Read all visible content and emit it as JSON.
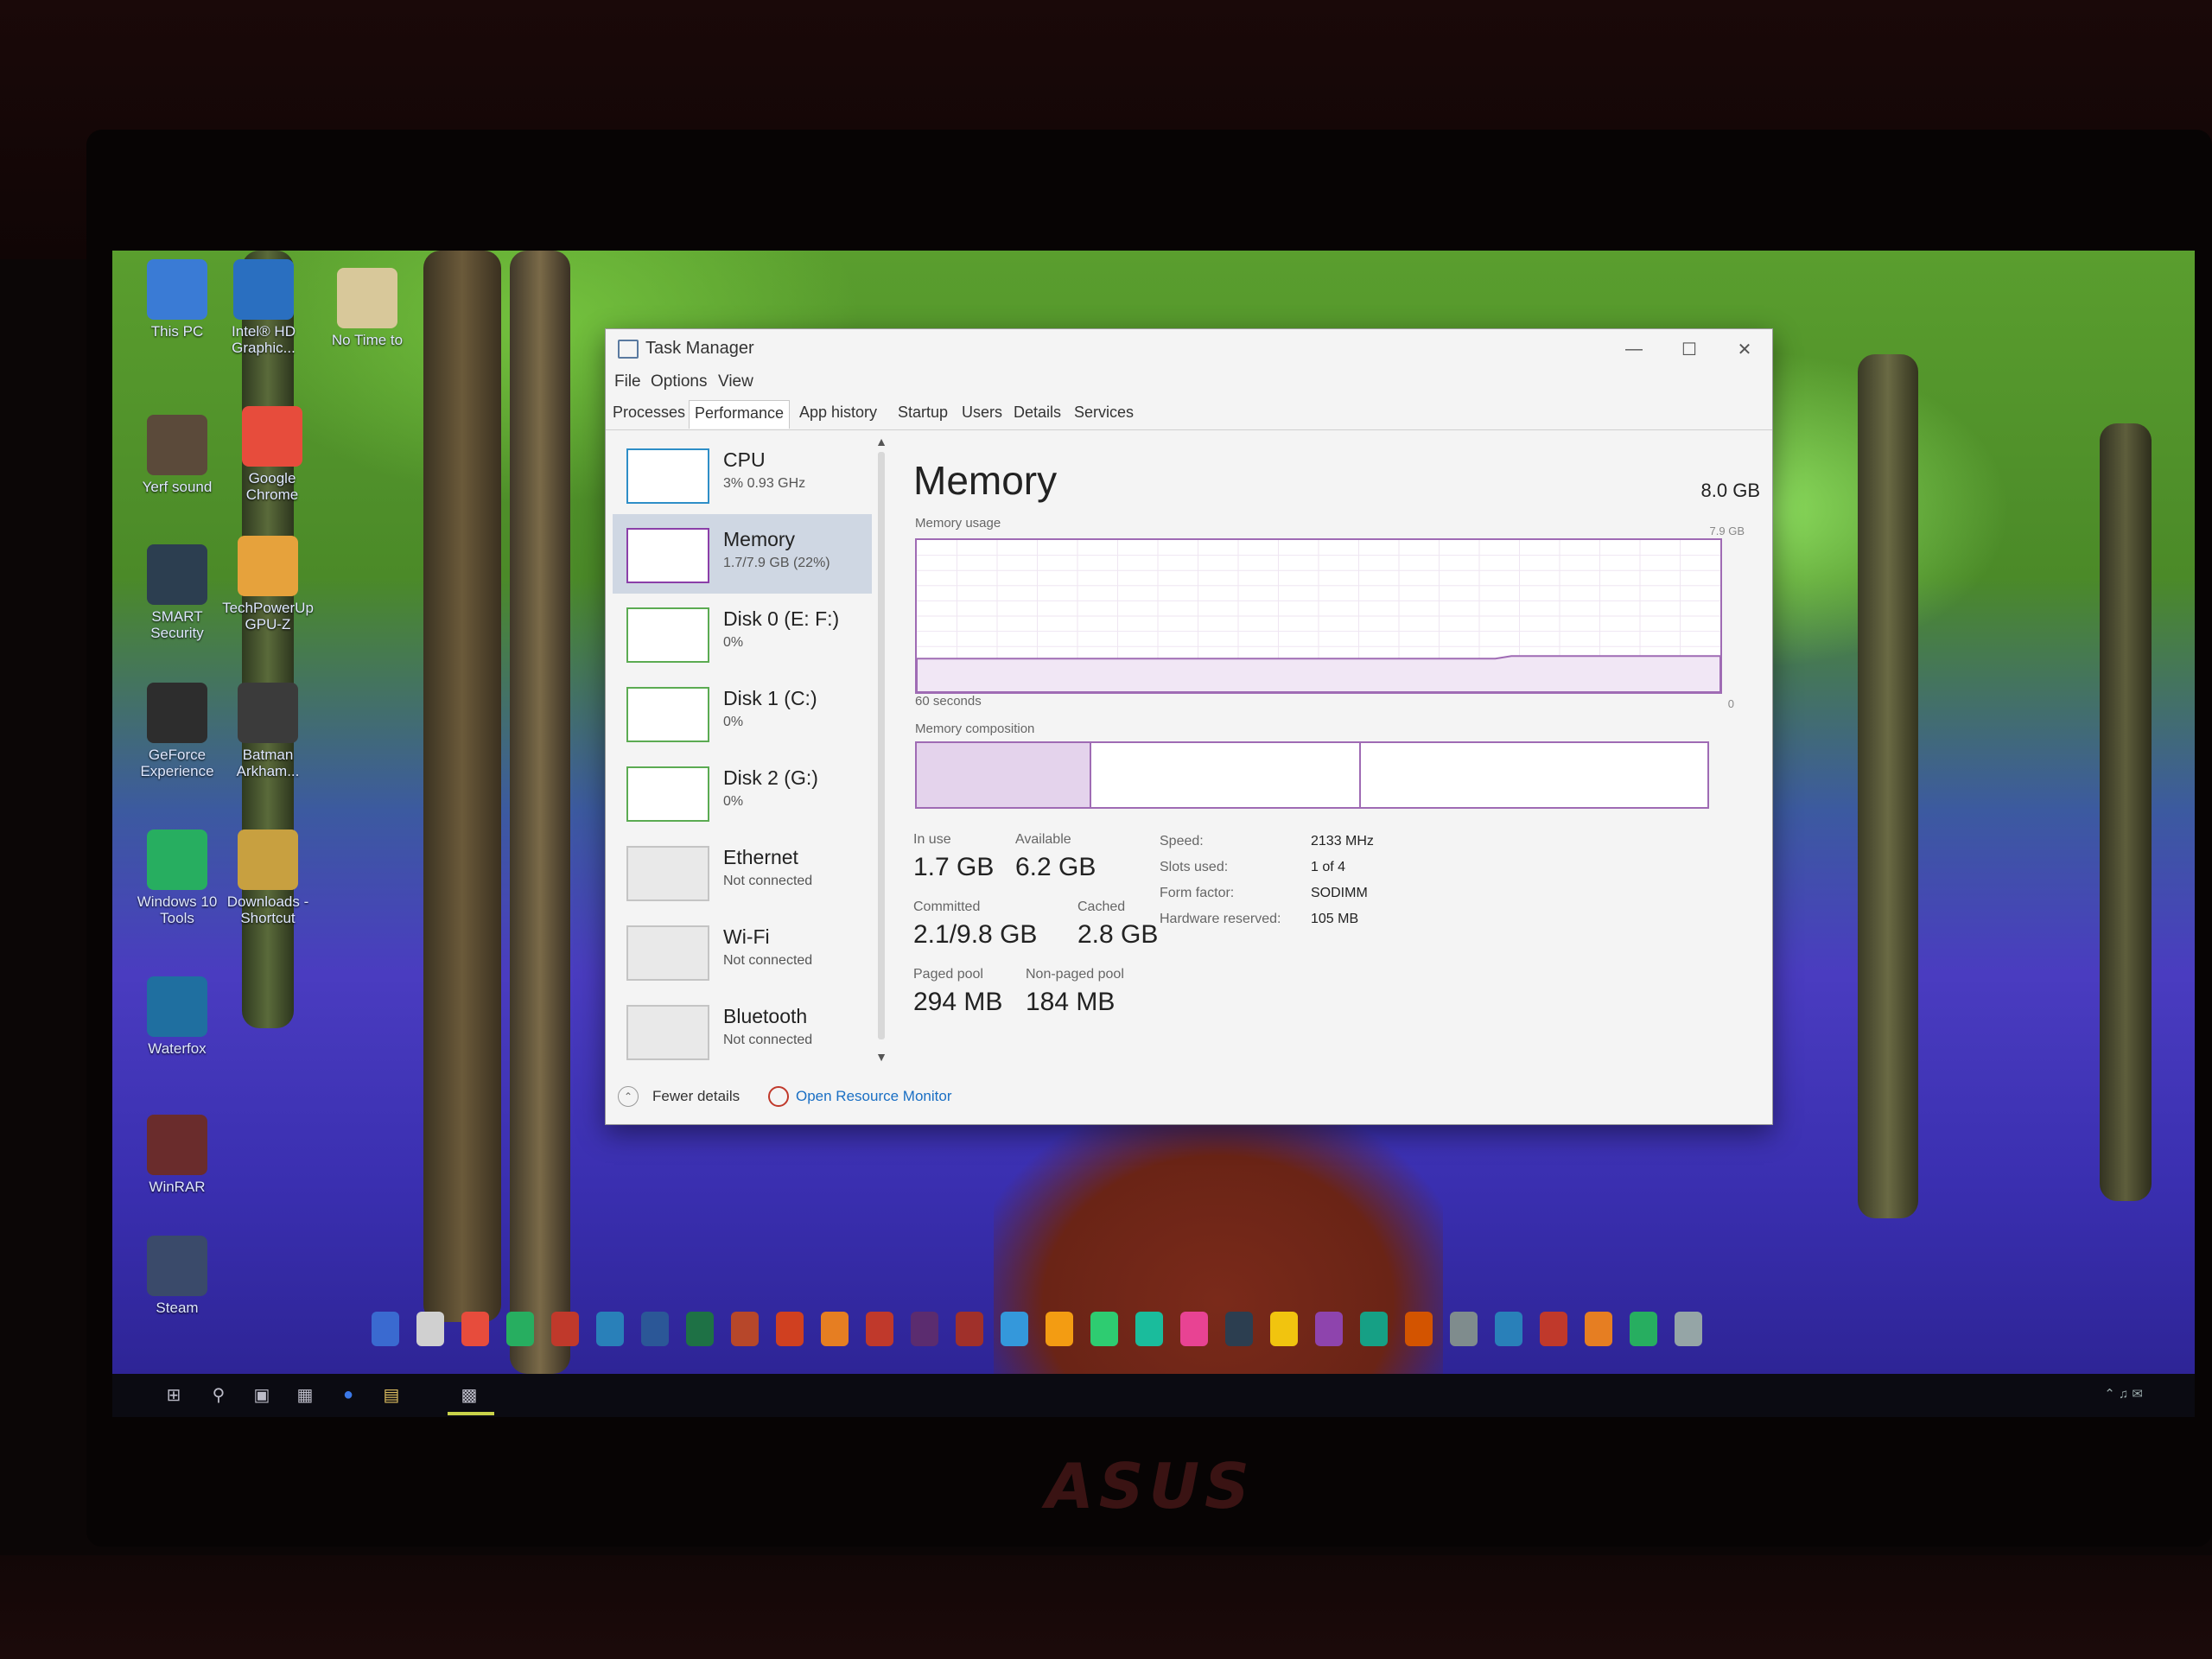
{
  "window": {
    "title": "Task Manager"
  },
  "menu": [
    "File",
    "Options",
    "View"
  ],
  "tabs": [
    "Processes",
    "Performance",
    "App history",
    "Startup",
    "Users",
    "Details",
    "Services"
  ],
  "resources": [
    {
      "name": "CPU",
      "sub": "3%  0.93 GHz"
    },
    {
      "name": "Memory",
      "sub": "1.7/7.9 GB (22%)"
    },
    {
      "name": "Disk 0 (E: F:)",
      "sub": "0%"
    },
    {
      "name": "Disk 1 (C:)",
      "sub": "0%"
    },
    {
      "name": "Disk 2 (G:)",
      "sub": "0%"
    },
    {
      "name": "Ethernet",
      "sub": "Not connected"
    },
    {
      "name": "Wi-Fi",
      "sub": "Not connected"
    },
    {
      "name": "Bluetooth",
      "sub": "Not connected"
    }
  ],
  "detail": {
    "title": "Memory",
    "total": "8.0 GB",
    "usage_label": "Memory usage",
    "usage_max": "7.9 GB",
    "time_label": "60 seconds",
    "zero_label": "0",
    "composition_label": "Memory composition",
    "stats": {
      "in_use_label": "In use",
      "in_use": "1.7 GB",
      "available_label": "Available",
      "available": "6.2 GB",
      "committed_label": "Committed",
      "committed": "2.1/9.8 GB",
      "cached_label": "Cached",
      "cached": "2.8 GB",
      "paged_label": "Paged pool",
      "paged": "294 MB",
      "nonpaged_label": "Non-paged pool",
      "nonpaged": "184 MB"
    },
    "props": {
      "speed_label": "Speed:",
      "speed": "2133 MHz",
      "slots_label": "Slots used:",
      "slots": "1 of 4",
      "form_label": "Form factor:",
      "form": "SODIMM",
      "hw_label": "Hardware reserved:",
      "hw": "105 MB"
    }
  },
  "footer": {
    "fewer": "Fewer details",
    "monitor": "Open Resource Monitor"
  },
  "desktop_icons": [
    {
      "label": "This PC",
      "icon": "computer-icon"
    },
    {
      "label": "Intel® HD Graphic...",
      "icon": "intel-graphics-icon"
    },
    {
      "label": "No Time to",
      "icon": "folder-icon"
    },
    {
      "label": "Yerf sound",
      "icon": "sound-file-icon"
    },
    {
      "label": "Google Chrome",
      "icon": "chrome-icon"
    },
    {
      "label": "SMART Security",
      "icon": "security-icon"
    },
    {
      "label": "TechPowerUp GPU-Z",
      "icon": "gpu-z-icon"
    },
    {
      "label": "GeForce Experience",
      "icon": "nvidia-icon"
    },
    {
      "label": "Batman Arkham...",
      "icon": "batman-icon"
    },
    {
      "label": "Windows 10 Tools",
      "icon": "globe-icon"
    },
    {
      "label": "Downloads - Shortcut",
      "icon": "downloads-icon"
    },
    {
      "label": "Waterfox",
      "icon": "waterfox-icon"
    },
    {
      "label": "WinRAR",
      "icon": "winrar-icon"
    },
    {
      "label": "Steam",
      "icon": "steam-icon"
    }
  ],
  "colors": {
    "memory_accent": "#8b3fa8",
    "cpu_accent": "#2e8ec7",
    "disk_accent": "#5bab52",
    "link": "#1a6fc4",
    "selection": "#cfd7e3"
  }
}
